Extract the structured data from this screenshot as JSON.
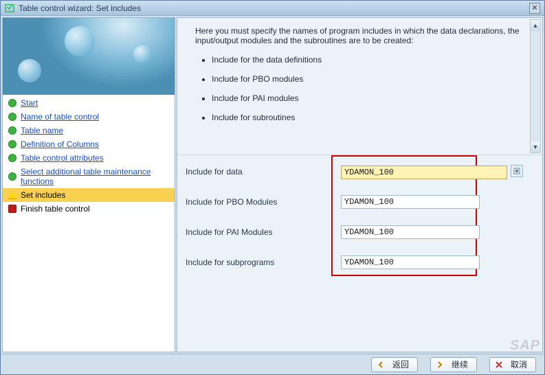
{
  "title": "Table control wizard: Set includes",
  "sidebar": {
    "items": [
      {
        "label": "Start",
        "kind": "done"
      },
      {
        "label": "Name of table control",
        "kind": "done"
      },
      {
        "label": "Table name",
        "kind": "done"
      },
      {
        "label": "Definition of Columns",
        "kind": "done"
      },
      {
        "label": "Table control attributes",
        "kind": "done"
      },
      {
        "label": "Select additional table maintenance functions",
        "kind": "done"
      },
      {
        "label": "Set includes",
        "kind": "active"
      },
      {
        "label": "Finish table control",
        "kind": "final"
      }
    ]
  },
  "instructions": {
    "intro": "Here you must specify the names of program includes in which the data declarations, the input/output modules and the subroutines are to be created:",
    "bullets": [
      "Include for the data definitions",
      "Include for PBO modules",
      "Include for PAI modules",
      "Include for subroutines"
    ]
  },
  "form": {
    "rows": [
      {
        "label": "Include for data",
        "value": "YDAMON_100",
        "f4": true,
        "active": true
      },
      {
        "label": "Include for PBO Modules",
        "value": "YDAMON_100",
        "f4": false,
        "active": false
      },
      {
        "label": "Include for PAI Modules",
        "value": "YDAMON_100",
        "f4": false,
        "active": false
      },
      {
        "label": "Include for subprograms",
        "value": "YDAMON_100",
        "f4": false,
        "active": false
      }
    ]
  },
  "footer": {
    "back": "返回",
    "continue": "继续",
    "cancel": "取消"
  },
  "watermark": "SAP"
}
